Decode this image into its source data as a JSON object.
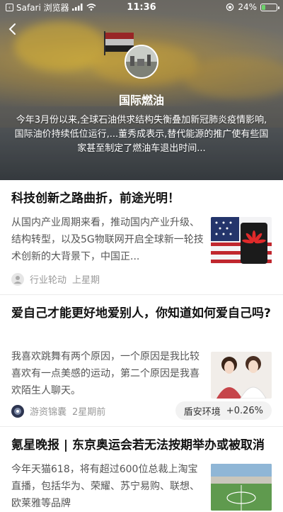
{
  "status_bar": {
    "back_app": "Safari 浏览器",
    "time": "11:36",
    "battery": "24%",
    "battery_level": 0.24
  },
  "channel": {
    "name": "国际燃油",
    "description": "今年3月份以来,全球石油供求结构失衡叠加新冠肺炎疫情影响,国际油价持续低位运行,...董秀成表示,替代能源的推广使有些国家甚至制定了燃油车退出时间..."
  },
  "articles": [
    {
      "title": "科技创新之路曲折，前途光明！",
      "summary": "从国内产业周期来看，推动国内产业升级、结构转型，以及5G物联网开启全球新一轮技术创新的大背景下，中国正...",
      "author": "行业轮动",
      "time": "上星期",
      "thumb_icon": "huawei-flag-image"
    },
    {
      "title": "爱自己才能更好地爱别人，你知道如何爱自己吗?",
      "summary": "我喜欢跳舞有两个原因，一个原因是我比较喜欢有一点美感的运动，第二个原因是我喜欢陌生人聊天。",
      "author": "游资锦囊",
      "time": "2星期前",
      "tag": {
        "name": "盾安环境",
        "change": "+0.26%"
      },
      "thumb_icon": "two-women-image"
    },
    {
      "title": "氪星晚报 | 东京奥运会若无法按期举办或被取消",
      "summary": "今年天猫618，将有超过600位总裁上淘宝直播，包括华为、荣耀、苏宁易购、联想、欧莱雅等品牌",
      "thumb_icon": "stadium-image"
    }
  ]
}
